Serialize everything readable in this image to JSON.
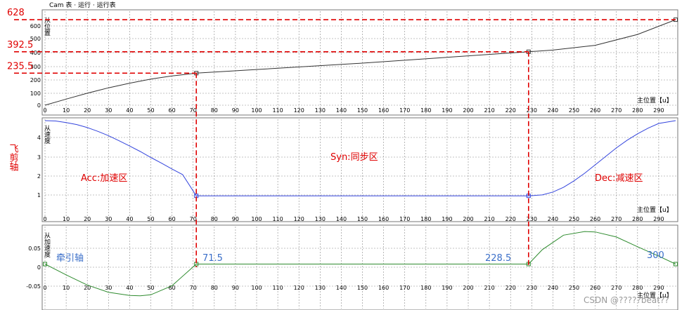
{
  "header_text": "Cam 表 · 运行 · 运行表",
  "watermark": "CSDN @?????beat??",
  "colors": {
    "position_curve": "#333333",
    "velocity_curve": "#3344dd",
    "accel_curve": "#2e8b2e",
    "dash_guides": "#e00000",
    "label_red": "#e00000",
    "label_blue": "#3b6fc9",
    "grid": "#888888"
  },
  "chart_data": [
    {
      "type": "line",
      "panel": "position",
      "x_ticks": [
        "0",
        "10",
        "20",
        "30",
        "40",
        "50",
        "60",
        "70",
        "80",
        "90",
        "100",
        "110",
        "120",
        "130",
        "140",
        "150",
        "160",
        "170",
        "180",
        "190",
        "200",
        "210",
        "220",
        "230",
        "240",
        "250",
        "260",
        "270",
        "280",
        "290"
      ],
      "y_ticks": [
        "0",
        "100",
        "200",
        "300",
        "400",
        "500",
        "600"
      ],
      "xlim": [
        0,
        298
      ],
      "ylim": [
        0,
        680
      ],
      "ylabel": "从位置",
      "xlabel": "主位置【u】",
      "series": [
        {
          "x": [
            0,
            10,
            20,
            30,
            40,
            50,
            60,
            71.5,
            100,
            150,
            228.5,
            240,
            260,
            280,
            298
          ],
          "y": [
            0,
            45,
            88,
            128,
            162,
            192,
            215,
            235.5,
            262,
            309,
            392.5,
            405,
            440,
            520,
            628
          ]
        }
      ],
      "markers": [
        {
          "x": 71.5,
          "y": 235.5
        },
        {
          "x": 228.5,
          "y": 392.5
        },
        {
          "x": 298,
          "y": 628
        }
      ],
      "guide_labels": [
        "628",
        "392.5",
        "235.5"
      ],
      "guide_values": [
        628,
        392.5,
        235.5
      ]
    },
    {
      "type": "line",
      "panel": "velocity",
      "x_ticks": [
        "0",
        "10",
        "20",
        "30",
        "40",
        "50",
        "60",
        "70",
        "80",
        "90",
        "100",
        "110",
        "120",
        "130",
        "140",
        "150",
        "160",
        "170",
        "180",
        "190",
        "200",
        "210",
        "220",
        "230",
        "240",
        "250",
        "260",
        "270",
        "280",
        "290"
      ],
      "y_ticks": [
        "1",
        "2",
        "3",
        "4"
      ],
      "xlim": [
        0,
        298
      ],
      "ylim": [
        0,
        5
      ],
      "ylabel": "从速度",
      "xlabel": "主位置【u】",
      "series": [
        {
          "x": [
            0,
            5,
            10,
            15,
            20,
            25,
            30,
            35,
            40,
            45,
            50,
            55,
            60,
            65,
            71.5,
            228.5,
            235,
            240,
            245,
            250,
            255,
            260,
            265,
            270,
            275,
            280,
            285,
            290,
            298
          ],
          "y": [
            5,
            4.98,
            4.9,
            4.79,
            4.63,
            4.43,
            4.2,
            3.93,
            3.65,
            3.36,
            3.04,
            2.74,
            2.43,
            2.13,
            1,
            1,
            1.05,
            1.2,
            1.45,
            1.8,
            2.2,
            2.65,
            3.1,
            3.55,
            3.95,
            4.3,
            4.6,
            4.85,
            5
          ]
        }
      ],
      "markers": [
        {
          "x": 71.5,
          "y": 1
        },
        {
          "x": 228.5,
          "y": 1
        }
      ],
      "annotations": [
        "Acc:加速区",
        "Syn:同步区",
        "Dec:减速区"
      ]
    },
    {
      "type": "line",
      "panel": "acceleration",
      "x_ticks": [
        "0",
        "10",
        "20",
        "30",
        "40",
        "50",
        "60",
        "70",
        "80",
        "90",
        "100",
        "110",
        "120",
        "130",
        "140",
        "150",
        "160",
        "170",
        "180",
        "190",
        "200",
        "210",
        "220",
        "230",
        "240",
        "250",
        "260",
        "270",
        "280",
        "290"
      ],
      "y_ticks": [
        "0.05",
        "0",
        "-0.05"
      ],
      "xlim": [
        0,
        298
      ],
      "ylim": [
        -0.1,
        0.1
      ],
      "ylabel": "从加速度",
      "xlabel": "主位置【u】",
      "series": [
        {
          "x": [
            0,
            10,
            20,
            30,
            40,
            45,
            50,
            60,
            71.5,
            228.5,
            235,
            245,
            255,
            260,
            270,
            280,
            290,
            298
          ],
          "y": [
            0,
            -0.03,
            -0.058,
            -0.078,
            -0.087,
            -0.088,
            -0.085,
            -0.06,
            0,
            0,
            0.04,
            0.08,
            0.09,
            0.089,
            0.075,
            0.048,
            0.022,
            0
          ]
        }
      ],
      "markers": [
        {
          "x": 0,
          "y": 0
        },
        {
          "x": 71.5,
          "y": 0
        },
        {
          "x": 228.5,
          "y": 0
        },
        {
          "x": 298,
          "y": 0
        }
      ],
      "annotations": [
        "牵引轴",
        "71.5",
        "228.5",
        "300"
      ]
    }
  ],
  "side_label": "飞剪轴"
}
